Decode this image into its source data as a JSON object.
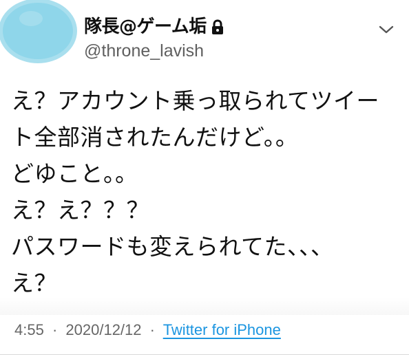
{
  "author": {
    "display_name": "隊長@ゲーム垢",
    "handle": "@throne_lavish",
    "avatar_color": "#8fd6ea",
    "lock_icon": "lock-icon"
  },
  "tweet": {
    "lines": [
      "え？アカウント乗っ取られてツイー",
      "ト全部消されたんだけど。。",
      "どゆこと。。",
      "え？え？？？",
      "パスワードも変えられてた、、、",
      "え？"
    ]
  },
  "meta": {
    "time": "4:55",
    "separator_1": "·",
    "date": "2020/12/12",
    "separator_2": "·",
    "source": "Twitter for iPhone",
    "source_color": "#1b95e0"
  },
  "controls": {
    "menu_icon": "chevron-down-icon"
  }
}
